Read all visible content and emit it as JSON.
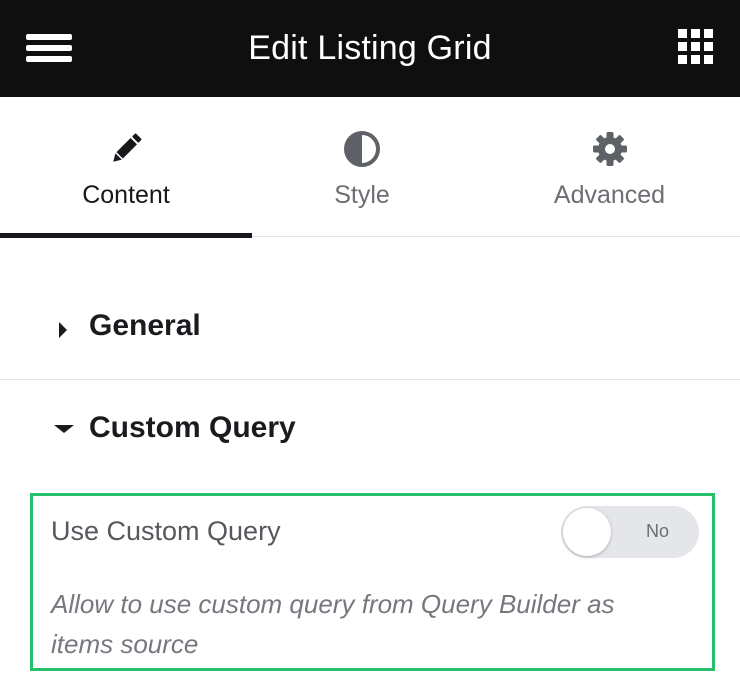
{
  "header": {
    "title": "Edit Listing Grid",
    "menu_icon": "hamburger-menu-icon",
    "apps_icon": "grid-apps-icon"
  },
  "tabs": [
    {
      "label": "Content",
      "icon": "pencil-icon",
      "active": true
    },
    {
      "label": "Style",
      "icon": "half-circle-contrast-icon",
      "active": false
    },
    {
      "label": "Advanced",
      "icon": "gear-icon",
      "active": false
    }
  ],
  "sections": {
    "general": {
      "title": "General",
      "expanded": false
    },
    "custom_query": {
      "title": "Custom Query",
      "expanded": true,
      "use_custom_query": {
        "label": "Use Custom Query",
        "toggle_text": "No",
        "value": false,
        "description": "Allow to use custom query from Query Builder as items source"
      }
    }
  },
  "colors": {
    "header_bg": "#0f0f10",
    "highlight_border": "#28bf6b",
    "active_tab_underline": "#17181b",
    "toggle_bg": "#e4e6ea"
  }
}
